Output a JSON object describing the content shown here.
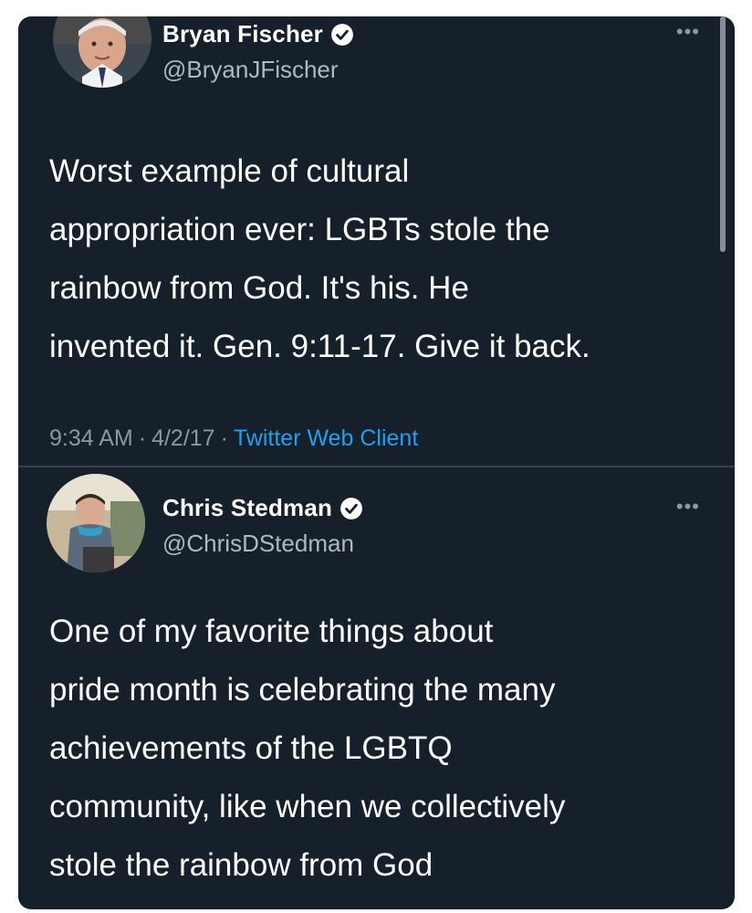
{
  "tweets": [
    {
      "name": "Bryan Fischer",
      "handle": "@BryanJFischer",
      "more": "•••",
      "text": "Worst example of cultural\nappropriation ever: LGBTs stole the\nrainbow from God. It's his. He\ninvented it. Gen. 9:11-17. Give it back.",
      "time": "9:34 AM",
      "separator": "·",
      "date": "4/2/17",
      "client_separator": "·",
      "client": "Twitter Web Client",
      "verified_icon": "verified-badge-icon"
    },
    {
      "name": "Chris Stedman",
      "handle": "@ChrisDStedman",
      "more": "•••",
      "text": "One of my favorite things about\npride month is celebrating the many\nachievements of the LGBTQ\ncommunity, like when we collectively\nstole the rainbow from God",
      "verified_icon": "verified-badge-icon"
    }
  ],
  "colors": {
    "background": "#15202b",
    "text": "#ffffff",
    "muted": "#8899a6",
    "link": "#1da1f2",
    "divider": "#38444d"
  }
}
